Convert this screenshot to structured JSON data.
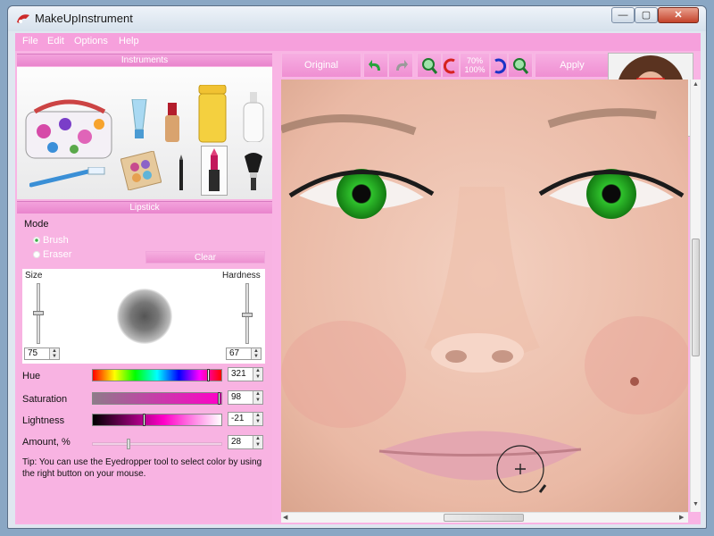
{
  "window": {
    "title": "MakeUpInstrument"
  },
  "menu": [
    "File",
    "Edit",
    "Options",
    "Help"
  ],
  "panels": {
    "instruments_header": "Instruments",
    "lipstick_header": "Lipstick"
  },
  "mode": {
    "label": "Mode",
    "brush": "Brush",
    "eraser": "Eraser",
    "selected": "Brush",
    "clear_label": "Clear"
  },
  "brush": {
    "size_label": "Size",
    "hardness_label": "Hardness",
    "size_value": "75",
    "hardness_value": "67"
  },
  "color": {
    "hue_label": "Hue",
    "hue_value": "321",
    "saturation_label": "Saturation",
    "saturation_value": "98",
    "lightness_label": "Lightness",
    "lightness_value": "-21",
    "amount_label": "Amount, %",
    "amount_value": "28"
  },
  "tip": "Tip: You can use the Eyedropper tool to select color by using the right button on your mouse.",
  "toolbar": {
    "original_label": "Original",
    "zoom_top": "70%",
    "zoom_bottom": "100%",
    "apply_label": "Apply"
  },
  "colors": {
    "accent_pink": "#f6a0dc",
    "eye_green": "#2fc12c"
  }
}
